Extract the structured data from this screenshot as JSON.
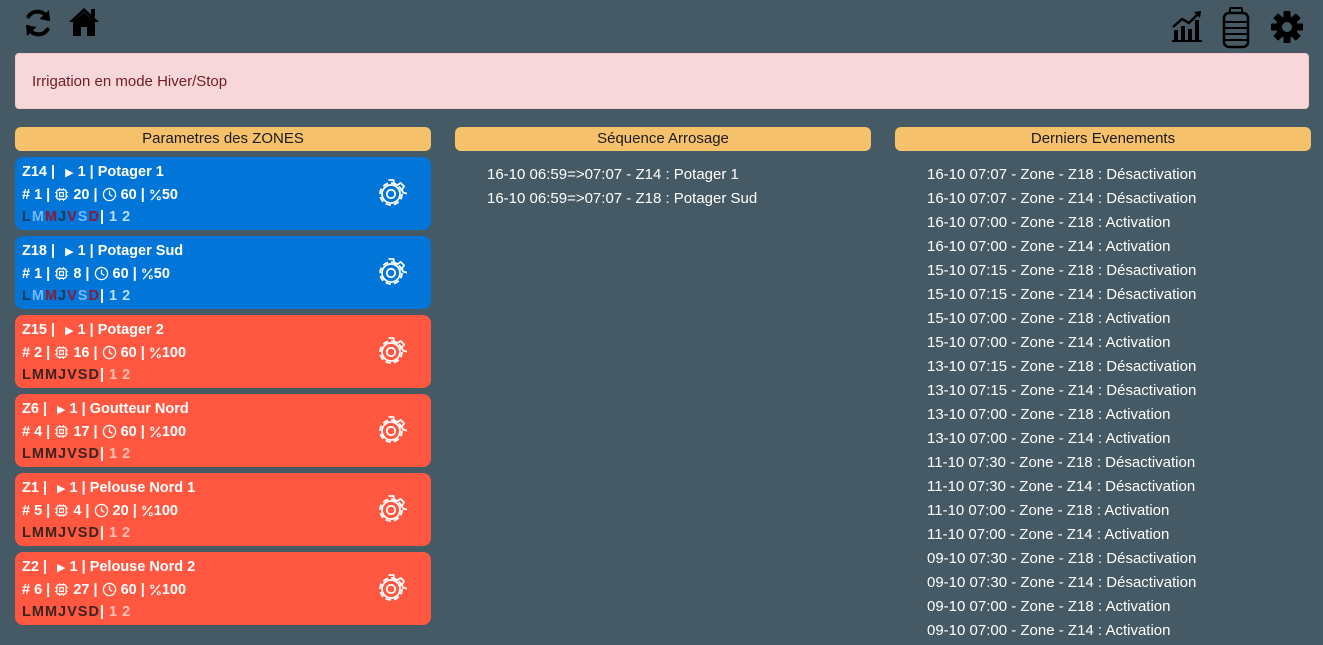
{
  "topbar": {
    "left_icons": [
      "refresh-icon",
      "home-icon"
    ],
    "right_icons": [
      "chart-icon",
      "water-tank-icon",
      "settings-gear-icon"
    ]
  },
  "alert": {
    "text": "Irrigation en mode Hiver/Stop"
  },
  "zones_panel": {
    "title": "Parametres des ZONES",
    "zones": [
      {
        "id": "Z14 | ",
        "cycles": "1 | Potager 1",
        "num": "# 1 | ",
        "dur": "20 | ",
        "time": "60 | ",
        "pct": "50",
        "state": "blue"
      },
      {
        "id": "Z18 | ",
        "cycles": "1 | Potager Sud",
        "num": "# 1 | ",
        "dur": "8 | ",
        "time": "60 | ",
        "pct": "50",
        "state": "blue"
      },
      {
        "id": "Z15 | ",
        "cycles": "1 | Potager 2",
        "num": "# 2 | ",
        "dur": "16 | ",
        "time": "60 | ",
        "pct": "100",
        "state": "red"
      },
      {
        "id": "Z6 | ",
        "cycles": "1 | Goutteur Nord",
        "num": "# 4 | ",
        "dur": "17 | ",
        "time": "60 | ",
        "pct": "100",
        "state": "red"
      },
      {
        "id": "Z1 | ",
        "cycles": "1 | Pelouse Nord 1",
        "num": "# 5 | ",
        "dur": "4 | ",
        "time": "20 | ",
        "pct": "100",
        "state": "red"
      },
      {
        "id": "Z2 | ",
        "cycles": "1 | Pelouse Nord 2",
        "num": "# 6 | ",
        "dur": "27 | ",
        "time": "60 | ",
        "pct": "100",
        "state": "red"
      }
    ],
    "days": [
      "L",
      "M",
      "M",
      "J",
      "V",
      "S",
      "D"
    ],
    "day_sep": "|",
    "cycles_label": "1 2"
  },
  "sequence_panel": {
    "title": "Séquence Arrosage",
    "items": [
      "16-10 06:59=>07:07 - Z14 : Potager 1",
      "16-10 06:59=>07:07 - Z18 : Potager Sud"
    ]
  },
  "events_panel": {
    "title": "Derniers Evenements",
    "items": [
      "16-10 07:07 - Zone - Z18 : Désactivation",
      "16-10 07:07 - Zone - Z14 : Désactivation",
      "16-10 07:00 - Zone - Z18 : Activation",
      "16-10 07:00 - Zone - Z14 : Activation",
      "15-10 07:15 - Zone - Z18 : Désactivation",
      "15-10 07:15 - Zone - Z14 : Désactivation",
      "15-10 07:00 - Zone - Z18 : Activation",
      "15-10 07:00 - Zone - Z14 : Activation",
      "13-10 07:15 - Zone - Z18 : Désactivation",
      "13-10 07:15 - Zone - Z14 : Désactivation",
      "13-10 07:00 - Zone - Z18 : Activation",
      "13-10 07:00 - Zone - Z14 : Activation",
      "11-10 07:30 - Zone - Z18 : Désactivation",
      "11-10 07:30 - Zone - Z14 : Désactivation",
      "11-10 07:00 - Zone - Z18 : Activation",
      "11-10 07:00 - Zone - Z14 : Activation",
      "09-10 07:30 - Zone - Z18 : Désactivation",
      "09-10 07:30 - Zone - Z14 : Désactivation",
      "09-10 07:00 - Zone - Z18 : Activation",
      "09-10 07:00 - Zone - Z14 : Activation"
    ]
  },
  "colors": {
    "background": "#455a64",
    "header_accent": "#f5c26b",
    "zone_active": "#0275d8",
    "zone_inactive": "#ff5740",
    "alert_bg": "#f8d7da",
    "alert_text": "#721c24"
  }
}
